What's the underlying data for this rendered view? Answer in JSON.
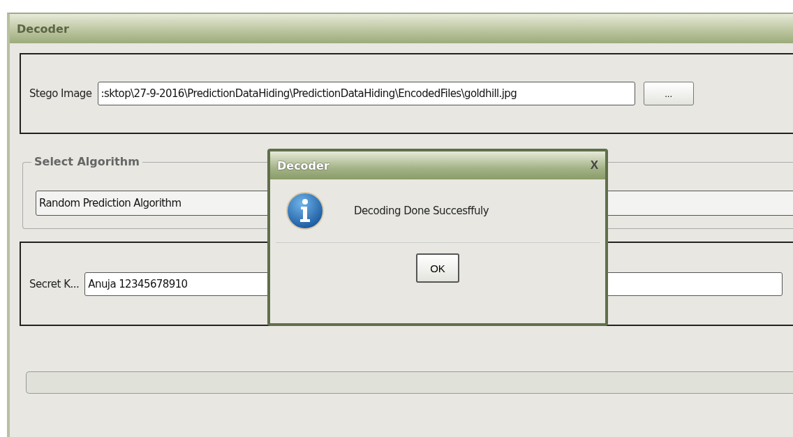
{
  "window": {
    "title": "Decoder"
  },
  "stego_image": {
    "label": "Stego Image",
    "value": ":sktop\\27-9-2016\\PredictionDataHiding\\PredictionDataHiding\\EncodedFiles\\goldhill.jpg",
    "browse_button": "..."
  },
  "algorithm": {
    "legend": "Select Algorithm",
    "value": "Random Prediction Algorithm"
  },
  "secret_key": {
    "label": "Secret K...",
    "value": "Anuja 12345678910"
  },
  "dialog": {
    "title": "Decoder",
    "close": "X",
    "message": "Decoding Done Succesffuly",
    "button": "OK"
  }
}
